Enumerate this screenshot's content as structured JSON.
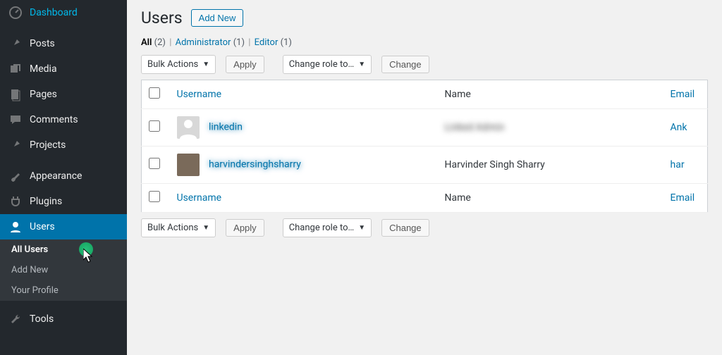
{
  "sidebar": {
    "items": [
      {
        "label": "Dashboard",
        "icon": "dashboard"
      },
      {
        "label": "Posts",
        "icon": "pin"
      },
      {
        "label": "Media",
        "icon": "media"
      },
      {
        "label": "Pages",
        "icon": "pages"
      },
      {
        "label": "Comments",
        "icon": "comment"
      },
      {
        "label": "Projects",
        "icon": "pin"
      },
      {
        "label": "Appearance",
        "icon": "brush"
      },
      {
        "label": "Plugins",
        "icon": "plug"
      },
      {
        "label": "Users",
        "icon": "user",
        "active": true
      },
      {
        "label": "Tools",
        "icon": "wrench"
      }
    ],
    "submenu": [
      {
        "label": "All Users",
        "current": true
      },
      {
        "label": "Add New"
      },
      {
        "label": "Your Profile"
      }
    ]
  },
  "page": {
    "title": "Users",
    "add_new": "Add New"
  },
  "filters": {
    "all": {
      "label": "All",
      "count": "(2)"
    },
    "administrator": {
      "label": "Administrator",
      "count": "(1)"
    },
    "editor": {
      "label": "Editor",
      "count": "(1)"
    }
  },
  "actions": {
    "bulk_label": "Bulk Actions",
    "apply": "Apply",
    "change_role_label": "Change role to…",
    "change": "Change"
  },
  "table": {
    "columns": {
      "username": "Username",
      "name": "Name",
      "email": "Email"
    },
    "rows": [
      {
        "username": "linkedin",
        "name": "Linked Admin",
        "email_partial": "Ank",
        "avatar": "gray"
      },
      {
        "username": "harvindersinghsharry",
        "name": "Harvinder Singh Sharry",
        "email_partial": "har",
        "avatar": "photo"
      }
    ]
  }
}
